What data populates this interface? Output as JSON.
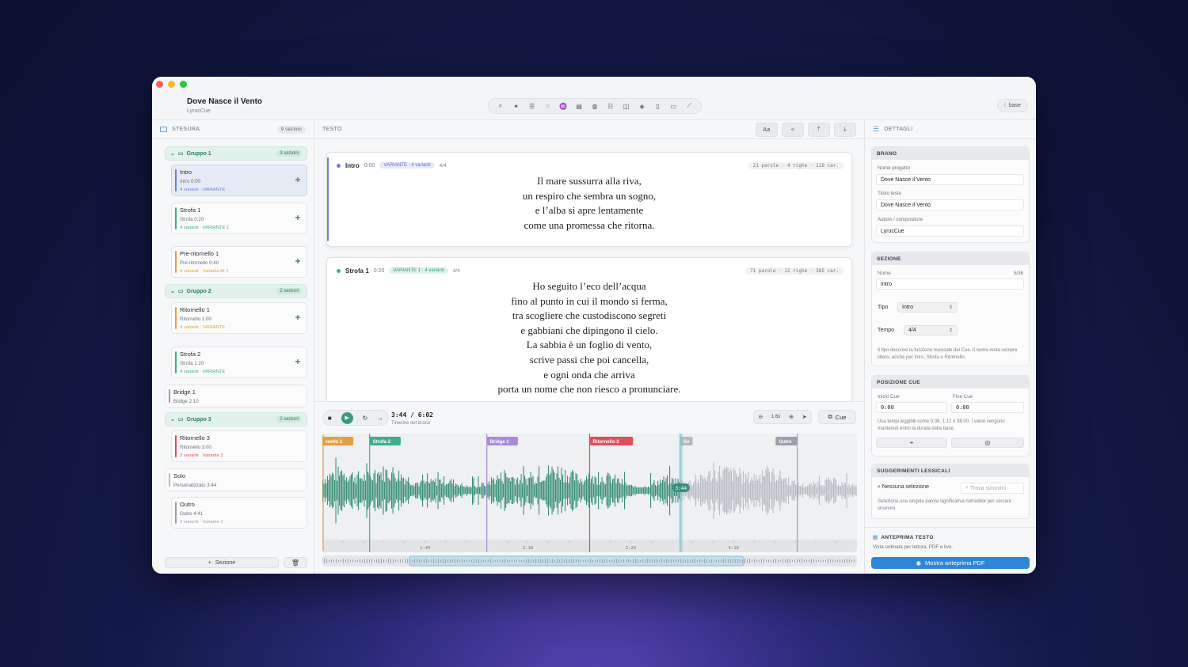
{
  "app": {
    "title": "Dove Nasce il Vento",
    "subtitle": "LyrucCue",
    "base_label": "base"
  },
  "left": {
    "title": "STESURA",
    "count": "9 sezioni",
    "groups": [
      {
        "label": "Gruppo 1",
        "count": "3 sezioni"
      },
      {
        "label": "Gruppo 2",
        "count": "2 sezioni"
      },
      {
        "label": "Gruppo 3",
        "count": "2 sezioni"
      }
    ],
    "cards": [
      {
        "title": "Intro",
        "meta": "Intro  0:00",
        "variant": "4 varianti · VARIANTE",
        "color": "#6b7fd6"
      },
      {
        "title": "Strofa 1",
        "meta": "Strofa  0:20",
        "variant": "4 varianti · VARIANTE 1",
        "color": "#3fae8a"
      },
      {
        "title": "Pre-ritornello 1",
        "meta": "Pre-ritornello  0:40",
        "variant": "4 varianti · Variante AI 2",
        "color": "#e2a043"
      },
      {
        "title": "Ritornello 1",
        "meta": "Ritornello  1:00",
        "variant": "4 varianti · VARIANTE",
        "color": "#e2a043"
      },
      {
        "title": "Strofa 2",
        "meta": "Strofa  1:20",
        "variant": "4 varianti · VARIANTE",
        "color": "#3fae8a"
      },
      {
        "title": "Bridge 1",
        "meta": "Bridge  2:10",
        "variant": "",
        "color": "#a98ad8"
      },
      {
        "title": "Ritornello 3",
        "meta": "Ritornello  3:00",
        "variant": "2 varianti · Variante 2",
        "color": "#e0505a"
      },
      {
        "title": "Solo",
        "meta": "Personalizzato  3:44",
        "variant": "",
        "color": "#b5b9c0"
      },
      {
        "title": "Outro",
        "meta": "Outro  4:41",
        "variant": "2 varianti · Variante 2",
        "color": "#9aa0aa"
      }
    ],
    "add_section": "Sezione"
  },
  "center": {
    "title": "TESTO",
    "font_btn": "Aa",
    "blocks": [
      {
        "name": "Intro",
        "time": "0:00",
        "pill": "VARIANTE · 4 varianti",
        "meter": "4/4",
        "stats": "21 parole · 4 righe · 118 car.",
        "lines": [
          "Il mare sussurra alla riva,",
          "un respiro che sembra un sogno,",
          "e l’alba si apre lentamente",
          "come una promessa che ritorna."
        ]
      },
      {
        "name": "Strofa 1",
        "time": "0:20",
        "pill": "VARIANTE 1 · 4 varianti",
        "meter": "4/4",
        "stats": "71 parole · 12 righe · 385 car.",
        "lines": [
          "Ho seguito l’eco dell’acqua",
          "fino al punto in cui il mondo si ferma,",
          "tra scogliere che custodiscono segreti",
          "e gabbiani che dipingono il cielo.",
          "La sabbia è un foglio di vento,",
          "scrive passi che poi cancella,",
          "e ogni onda che arriva",
          "porta un nome che non riesco a pronunciare."
        ]
      }
    ],
    "player": {
      "time": "3:44 / 6:02",
      "time_sub": "Timeline del brano",
      "zoom": "1.6x",
      "cue_label": "Cue",
      "playhead_label": "3:44",
      "playhead_sec": 224,
      "duration_sec": 362,
      "view_start_sec": 50,
      "view_end_sec": 310,
      "ticks": [
        "1:40",
        "2:30",
        "3:20",
        "4:10"
      ],
      "markers": [
        {
          "label": "rnello 1",
          "sec": 50,
          "color": "#e2a043"
        },
        {
          "label": "Strofa 2",
          "sec": 73,
          "color": "#3fae8a"
        },
        {
          "label": "Bridge 1",
          "sec": 130,
          "color": "#a98ad8"
        },
        {
          "label": "Ritornello 3",
          "sec": 180,
          "color": "#e0505a"
        },
        {
          "label": "So",
          "sec": 224,
          "color": "#b5b9c0"
        },
        {
          "label": "Outro",
          "sec": 281,
          "color": "#9aa0aa"
        }
      ]
    }
  },
  "right": {
    "title": "DETTAGLI",
    "brano": {
      "title": "BRANO",
      "project_label": "Nome progetto",
      "project": "Dove Nasce il Vento",
      "text_label": "Titolo testo",
      "text": "Dove Nasce il Vento",
      "author_label": "Autore / compositore",
      "author": "LyrucCue"
    },
    "sezione": {
      "title": "SEZIONE",
      "name_label": "Nome",
      "name_count": "5/36",
      "name": "Intro",
      "type_label": "Tipo",
      "type": "Intro",
      "tempo_label": "Tempo",
      "tempo": "4/4",
      "hint": "Il tipo descrive la funzione musicale del Cue. Il nome resta sempre libero, anche per Intro, Strofa o Ritornello."
    },
    "posizione": {
      "title": "POSIZIONE CUE",
      "start_label": "Inizio Cue",
      "start": "0:00",
      "end_label": "Fine Cue",
      "end": "0:00",
      "hint": "Usa tempi leggibili come 0:38, 1:12 o 38:00. I valori vengono mantenuti entro la durata della base."
    },
    "suggerimenti": {
      "title": "SUGGERIMENTI LESSICALI",
      "selection": "Nessuna selezione",
      "search_placeholder": "Trova sinonimi",
      "hint": "Seleziona una singola parola significativa nell’editor per cercare sinonimi."
    },
    "anteprima": {
      "title": "ANTEPRIMA TESTO",
      "sub": "Vista ordinata per lettura, PDF e live.",
      "button": "Mostra anteprima PDF"
    }
  }
}
